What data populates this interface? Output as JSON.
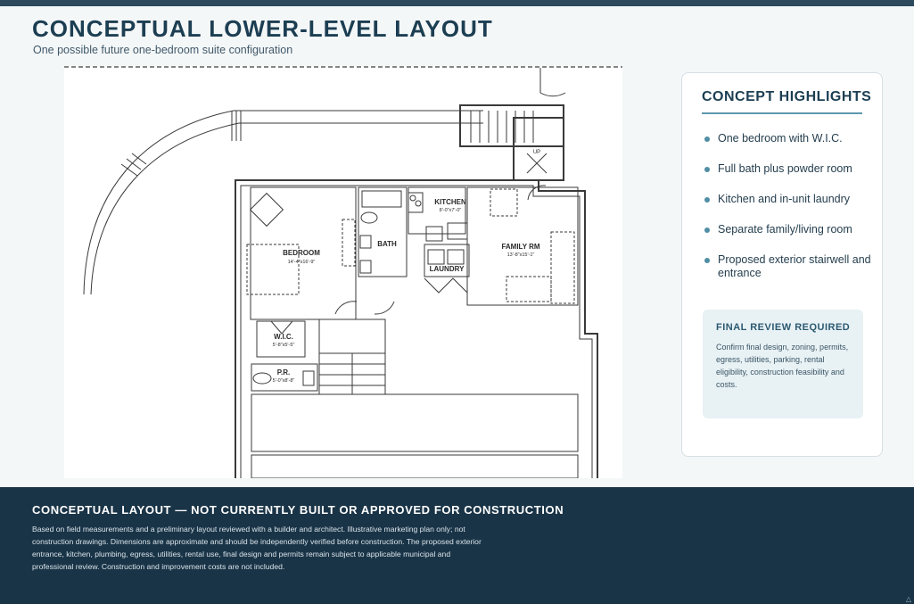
{
  "header": {
    "title": "CONCEPTUAL LOWER-LEVEL LAYOUT",
    "subtitle": "One possible future one-bedroom suite configuration"
  },
  "floor_plan": {
    "rooms": {
      "bedroom": {
        "name": "BEDROOM",
        "size": "14'-4\"x16'-9\""
      },
      "wic": {
        "name": "W.I.C.",
        "size": "5'-8\"x5'-5\""
      },
      "pr": {
        "name": "P.R.",
        "size": "5'-0\"x8'-8\""
      },
      "bath": {
        "name": "BATH"
      },
      "kitchen": {
        "name": "KITCHEN",
        "size": "8'-0\"x7'-0\""
      },
      "laundry": {
        "name": "LAUNDRY"
      },
      "family": {
        "name": "FAMILY RM",
        "size": "13'-8\"x15'-1\""
      },
      "up": {
        "name": "UP"
      }
    }
  },
  "highlights": {
    "title": "CONCEPT HIGHLIGHTS",
    "items": [
      "One bedroom with W.I.C.",
      "Full bath plus powder room",
      "Kitchen and in-unit laundry",
      "Separate family/living room",
      "Proposed exterior stairwell and entrance"
    ],
    "review": {
      "title": "FINAL REVIEW REQUIRED",
      "text": "Confirm final design, zoning, permits, egress, utilities, parking, rental eligibility, construction feasibility and costs."
    }
  },
  "footer": {
    "title": "CONCEPTUAL LAYOUT — NOT CURRENTLY BUILT OR APPROVED FOR CONSTRUCTION",
    "text": "Based on field measurements and a preliminary layout reviewed with a builder and architect. Illustrative marketing plan only; not construction drawings. Dimensions are approximate and should be independently verified before construction. The proposed exterior entrance, kitchen, plumbing, egress, utilities, rental use, final design and permits remain subject to applicable municipal and professional review. Construction and improvement costs are not included."
  },
  "colors": {
    "brand": "#1c3e52",
    "accent": "#5d98ae",
    "footer_bg": "#1a3447",
    "review_bg": "#e8f1f4"
  }
}
